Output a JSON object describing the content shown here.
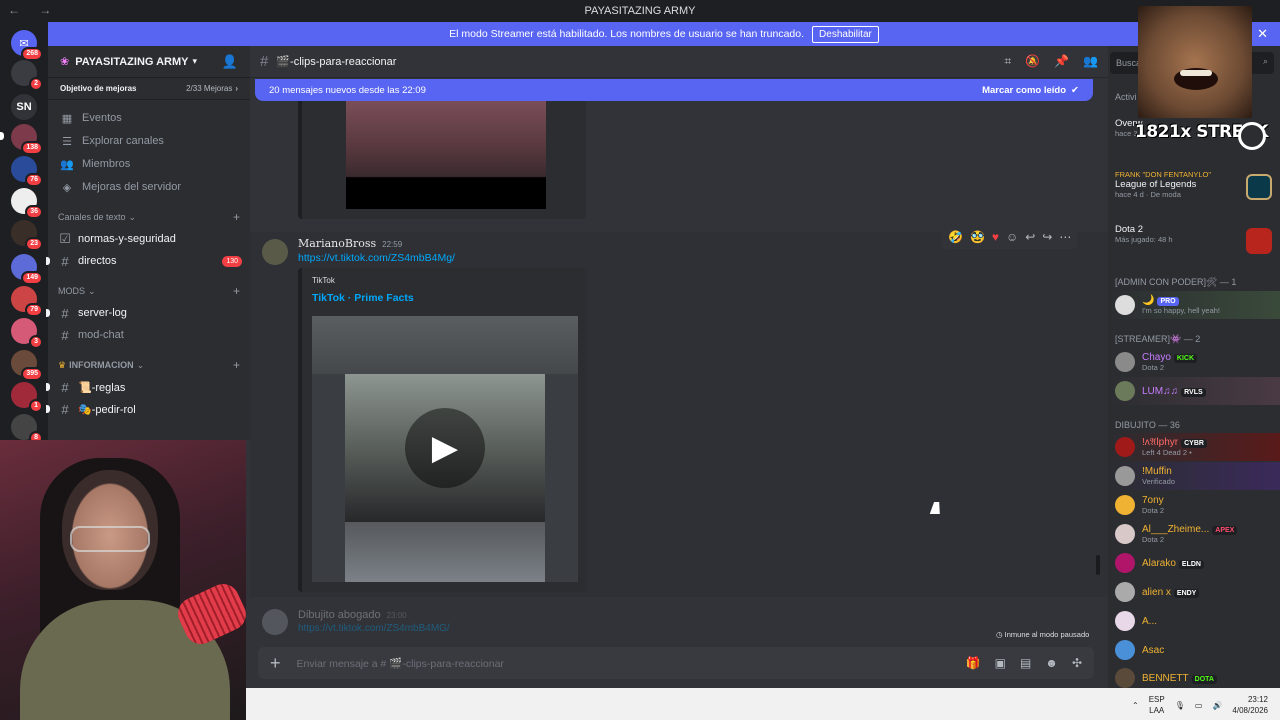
{
  "window": {
    "title": "PAYASITAZING ARMY"
  },
  "streamer_banner": {
    "text": "El modo Streamer está habilitado. Los nombres de usuario se han truncado.",
    "button": "Deshabilitar"
  },
  "guilds": [
    {
      "label": "",
      "badge": "268"
    },
    {
      "label": "",
      "badge": "2"
    },
    {
      "label": "SN",
      "badge": ""
    },
    {
      "label": "",
      "badge": "138"
    },
    {
      "label": "",
      "badge": "76"
    },
    {
      "label": "",
      "badge": "36"
    },
    {
      "label": "",
      "badge": "23"
    },
    {
      "label": "",
      "badge": "149"
    },
    {
      "label": "",
      "badge": "79"
    },
    {
      "label": "",
      "badge": "3"
    },
    {
      "label": "",
      "badge": "395"
    },
    {
      "label": "",
      "badge": "1"
    },
    {
      "label": "",
      "badge": "8"
    }
  ],
  "server": {
    "name": "PAYASITAZING ARMY",
    "boost_goal": "Objetivo de mejoras",
    "boost_count": "2/33 Mejoras",
    "menu": [
      "Eventos",
      "Explorar canales",
      "Miembros",
      "Mejoras del servidor"
    ],
    "categories": [
      {
        "name": "Canales de texto",
        "channels": [
          {
            "name": "normas-y-seguridad",
            "badge": ""
          },
          {
            "name": "directos",
            "badge": "130"
          }
        ]
      },
      {
        "name": "MODS",
        "channels": [
          {
            "name": "server-log",
            "badge": ""
          },
          {
            "name": "mod-chat",
            "badge": ""
          }
        ]
      },
      {
        "name": "INFORMACION",
        "channels": [
          {
            "name": "📜-reglas",
            "badge": ""
          },
          {
            "name": "🎭-pedir-rol",
            "badge": ""
          }
        ]
      }
    ]
  },
  "channel": {
    "name": "🎬-clips-para-reaccionar"
  },
  "new_messages": {
    "text": "20 mensajes nuevos desde las 22:09",
    "action": "Marcar como leído"
  },
  "message": {
    "author": "MarianoBross",
    "time": "22:59",
    "link": "https://vt.tiktok.com/ZS4mbB4Mg/",
    "embed_provider": "TikTok",
    "embed_title": "TikTok · Prime Facts"
  },
  "next_message": {
    "author": "Dibujito abogado",
    "time": "23:00",
    "link": "https://vt.tiktok.com/ZS4mbB4MG/"
  },
  "slowmode": "Inmune al modo pausado",
  "composer": {
    "placeholder": "Enviar mensaje a # 🎬-clips-para-reaccionar"
  },
  "members": {
    "search": "Busca",
    "activity_title": "Activi",
    "activities": [
      {
        "sub": "",
        "game": "Overw",
        "meta": "hace 3 d"
      },
      {
        "sub": "FRANK \"DON FENTANYLO\"",
        "game": "League of Legends",
        "meta": "hace 4 d · De moda"
      },
      {
        "sub": "",
        "game": "Dota 2",
        "meta": "Más jugado: 48 h"
      }
    ],
    "sections": [
      {
        "title": "[ADMIN CON PODER]🛠 — 1",
        "members": [
          {
            "name": "🌙",
            "sub": "I'm so happy, hell yeah!",
            "tag": "PRO"
          }
        ]
      },
      {
        "title": "[STREAMER]👾 — 2",
        "members": [
          {
            "name": "Chayo",
            "sub": "Dota 2",
            "tag": "KICK"
          },
          {
            "name": "LUM♫♫",
            "sub": "",
            "tag": "RVLS"
          }
        ]
      },
      {
        "title": "DIBUJITO — 36",
        "members": [
          {
            "name": "!ʌ𝔄lphyr",
            "sub": "Left 4 Dead 2 •",
            "tag": "CYBR"
          },
          {
            "name": "!Muffin",
            "sub": "Verificado",
            "tag": ""
          },
          {
            "name": "7ony",
            "sub": "Dota 2",
            "tag": ""
          },
          {
            "name": "Al___Zheime...",
            "sub": "Dota 2",
            "tag": "APEX"
          },
          {
            "name": "Alarako",
            "sub": "",
            "tag": "ELDN"
          },
          {
            "name": "alien x",
            "sub": "",
            "tag": "ENDY"
          },
          {
            "name": "A...",
            "sub": "",
            "tag": ""
          },
          {
            "name": "Asac",
            "sub": "",
            "tag": ""
          },
          {
            "name": "BENNETT",
            "sub": "",
            "tag": "DOTA"
          }
        ]
      }
    ]
  },
  "overlay": {
    "streak_text": "1821x STREAK"
  },
  "taskbar": {
    "lang": "ESP",
    "lang_sub": "LAA",
    "time": "23:12",
    "date": "4/08/2026"
  }
}
